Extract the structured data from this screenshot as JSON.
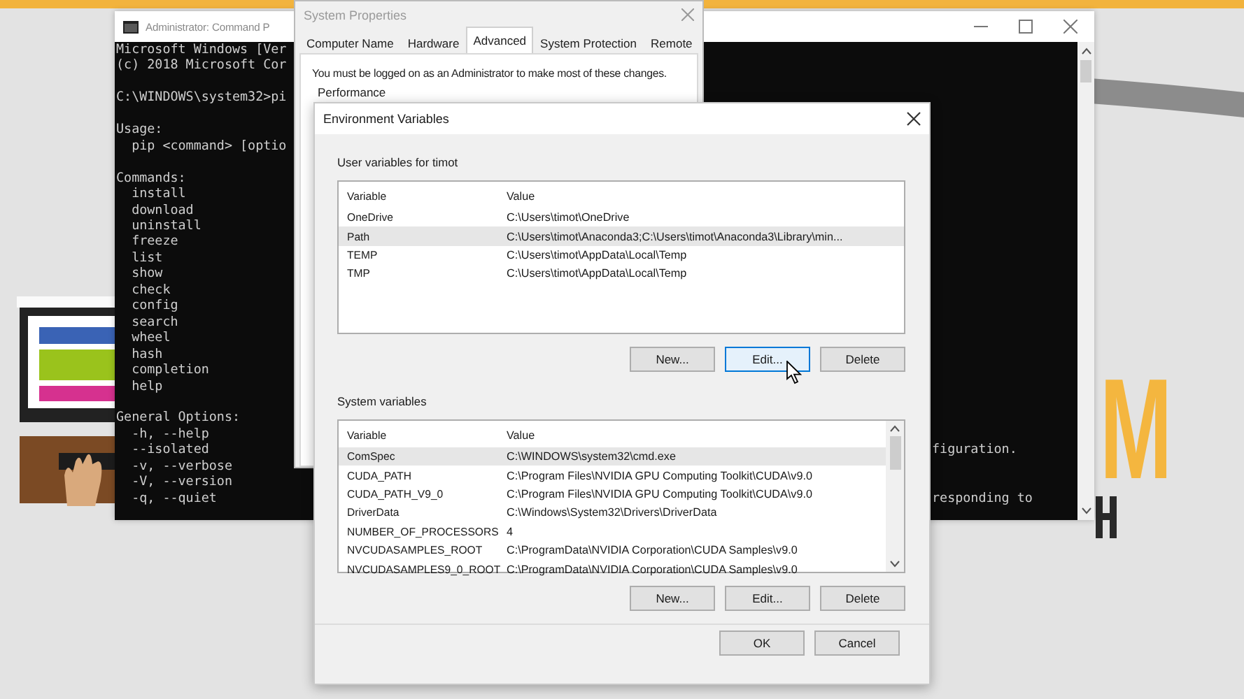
{
  "background_logo": {
    "letter": "M"
  },
  "command_window": {
    "title": "Administrator: Command P",
    "lines": [
      {
        "text": "Microsoft Windows [Ver"
      },
      {
        "text": "(c) 2018 Microsoft Cor"
      },
      {
        "text": "C:\\WINDOWS\\system32>pi",
        "blank_before": true
      },
      {
        "text": "Usage:",
        "blank_before": true
      },
      {
        "text": "  pip <command> [optio"
      },
      {
        "text": "Commands:",
        "blank_before": true
      },
      {
        "text": "  install"
      },
      {
        "text": "  download"
      },
      {
        "text": "  uninstall"
      },
      {
        "text": "  freeze"
      },
      {
        "text": "  list"
      },
      {
        "text": "  show"
      },
      {
        "text": "  check"
      },
      {
        "text": "  config"
      },
      {
        "text": "  search"
      },
      {
        "text": "  wheel"
      },
      {
        "text": "  hash"
      },
      {
        "text": "  completion"
      },
      {
        "text": "  help"
      },
      {
        "text": "General Options:",
        "blank_before": true
      },
      {
        "text": "  -h, --help"
      },
      {
        "text": "  --isolated",
        "right": "figuration."
      },
      {
        "text": "  -v, --verbose"
      },
      {
        "text": "  -V, --version"
      },
      {
        "text": "  -q, --quiet",
        "right": "responding to"
      }
    ]
  },
  "system_properties": {
    "title": "System Properties",
    "tabs": [
      {
        "label": "Computer Name",
        "selected": false
      },
      {
        "label": "Hardware",
        "selected": false
      },
      {
        "label": "Advanced",
        "selected": true
      },
      {
        "label": "System Protection",
        "selected": false
      },
      {
        "label": "Remote",
        "selected": false
      }
    ],
    "notice": "You must be logged on as an Administrator to make most of these changes.",
    "group_label": "Performance"
  },
  "environment_variables": {
    "title": "Environment Variables",
    "sections": [
      {
        "label": "User variables for timot",
        "scrollable": false,
        "columns": [
          "Variable",
          "Value"
        ],
        "rows": [
          {
            "variable": "OneDrive",
            "value": "C:\\Users\\timot\\OneDrive",
            "selected": false
          },
          {
            "variable": "Path",
            "value": "C:\\Users\\timot\\Anaconda3;C:\\Users\\timot\\Anaconda3\\Library\\min...",
            "selected": true
          },
          {
            "variable": "TEMP",
            "value": "C:\\Users\\timot\\AppData\\Local\\Temp",
            "selected": false
          },
          {
            "variable": "TMP",
            "value": "C:\\Users\\timot\\AppData\\Local\\Temp",
            "selected": false
          }
        ],
        "buttons": [
          {
            "label": "New...",
            "focused": false
          },
          {
            "label": "Edit...",
            "focused": true
          },
          {
            "label": "Delete",
            "focused": false
          }
        ]
      },
      {
        "label": "System variables",
        "scrollable": true,
        "columns": [
          "Variable",
          "Value"
        ],
        "rows": [
          {
            "variable": "ComSpec",
            "value": "C:\\WINDOWS\\system32\\cmd.exe",
            "selected": true
          },
          {
            "variable": "CUDA_PATH",
            "value": "C:\\Program Files\\NVIDIA GPU Computing Toolkit\\CUDA\\v9.0",
            "selected": false
          },
          {
            "variable": "CUDA_PATH_V9_0",
            "value": "C:\\Program Files\\NVIDIA GPU Computing Toolkit\\CUDA\\v9.0",
            "selected": false
          },
          {
            "variable": "DriverData",
            "value": "C:\\Windows\\System32\\Drivers\\DriverData",
            "selected": false
          },
          {
            "variable": "NUMBER_OF_PROCESSORS",
            "value": "4",
            "selected": false
          },
          {
            "variable": "NVCUDASAMPLES_ROOT",
            "value": "C:\\ProgramData\\NVIDIA Corporation\\CUDA Samples\\v9.0",
            "selected": false
          },
          {
            "variable": "NVCUDASAMPLES9_0_ROOT",
            "value": "C:\\ProgramData\\NVIDIA Corporation\\CUDA Samples\\v9.0",
            "selected": false
          }
        ],
        "buttons": [
          {
            "label": "New...",
            "focused": false
          },
          {
            "label": "Edit...",
            "focused": false
          },
          {
            "label": "Delete",
            "focused": false
          }
        ]
      }
    ],
    "buttons": [
      {
        "label": "OK",
        "focused": false
      },
      {
        "label": "Cancel",
        "focused": false
      }
    ]
  }
}
